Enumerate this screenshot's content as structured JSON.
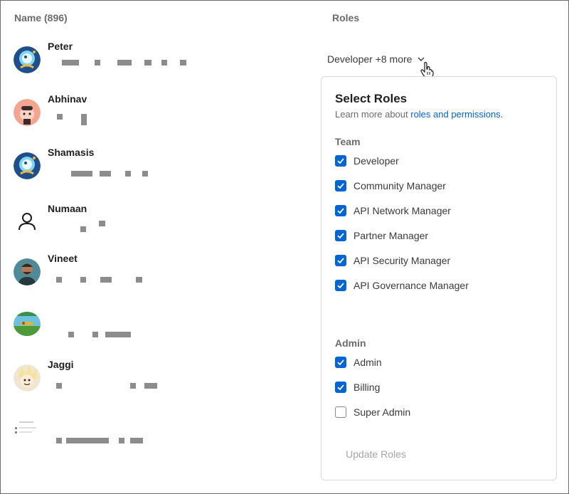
{
  "columns": {
    "name": "Name (896)",
    "roles": "Roles"
  },
  "users": [
    {
      "name": "Peter",
      "avatar": "astronaut-avatar"
    },
    {
      "name": "Abhinav",
      "avatar": "pink-character-avatar"
    },
    {
      "name": "Shamasis",
      "avatar": "astronaut-avatar"
    },
    {
      "name": "Numaan",
      "avatar": "default-user-icon"
    },
    {
      "name": "Vineet",
      "avatar": "photo-avatar"
    },
    {
      "name": "",
      "avatar": "landscape-avatar"
    },
    {
      "name": "Jaggi",
      "avatar": "cartoon-avatar"
    },
    {
      "name": "",
      "avatar": "document-avatar"
    }
  ],
  "role_toggle": {
    "label": "Developer +8 more",
    "icon": "chevron-down-icon"
  },
  "panel": {
    "title": "Select Roles",
    "subtitle_prefix": "Learn more about ",
    "subtitle_link": "roles and permissions.",
    "groups": [
      {
        "label": "Team",
        "roles": [
          {
            "label": "Developer",
            "checked": true
          },
          {
            "label": "Community Manager",
            "checked": true
          },
          {
            "label": "API Network Manager",
            "checked": true
          },
          {
            "label": "Partner Manager",
            "checked": true
          },
          {
            "label": "API Security Manager",
            "checked": true
          },
          {
            "label": "API Governance Manager",
            "checked": true
          }
        ]
      },
      {
        "label": "Admin",
        "roles": [
          {
            "label": "Admin",
            "checked": true
          },
          {
            "label": "Billing",
            "checked": true
          },
          {
            "label": "Super Admin",
            "checked": false
          }
        ]
      }
    ],
    "update_button": "Update Roles"
  },
  "colors": {
    "accent": "#0265d2",
    "muted": "#6b6b6b",
    "disabled": "#a6a6a6"
  }
}
